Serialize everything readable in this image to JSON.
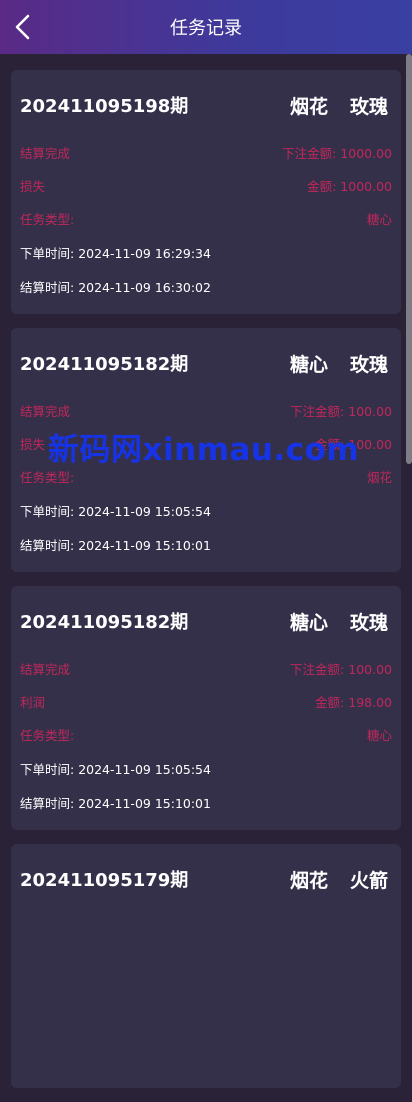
{
  "header": {
    "title": "任务记录"
  },
  "labels": {
    "settled": "结算完成",
    "bet_amount_label": "下注金额:",
    "amount_label": "金额:",
    "task_type_label": "任务类型:",
    "order_time_label": "下单时间:",
    "settle_time_label": "结算时间:"
  },
  "records": [
    {
      "period": "202411095198期",
      "tag1": "烟花",
      "tag2": "玫瑰",
      "status": "结算完成",
      "result": "损失",
      "bet": "1000.00",
      "amount": "1000.00",
      "task_type": "糖心",
      "order_time": "2024-11-09 16:29:34",
      "settle_time": "2024-11-09 16:30:02"
    },
    {
      "period": "202411095182期",
      "tag1": "糖心",
      "tag2": "玫瑰",
      "status": "结算完成",
      "result": "损失",
      "bet": "100.00",
      "amount": "100.00",
      "task_type": "烟花",
      "order_time": "2024-11-09 15:05:54",
      "settle_time": "2024-11-09 15:10:01"
    },
    {
      "period": "202411095182期",
      "tag1": "糖心",
      "tag2": "玫瑰",
      "status": "结算完成",
      "result": "利润",
      "bet": "100.00",
      "amount": "198.00",
      "task_type": "糖心",
      "order_time": "2024-11-09 15:05:54",
      "settle_time": "2024-11-09 15:10:01"
    },
    {
      "period": "202411095179期",
      "tag1": "烟花",
      "tag2": "火箭"
    }
  ],
  "watermark": "新码网xinmau.com",
  "colors": {
    "accent_pink": "#c0275a",
    "card_bg": "#35304a",
    "page_bg": "#2a2337"
  }
}
